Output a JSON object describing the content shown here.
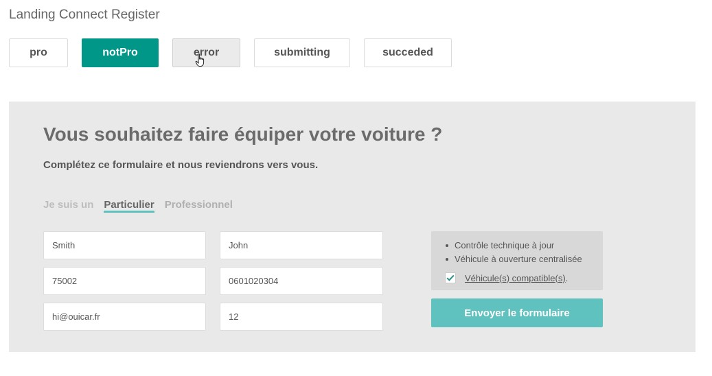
{
  "header": {
    "title": "Landing Connect Register"
  },
  "state_tabs": [
    {
      "label": "pro",
      "state": "default"
    },
    {
      "label": "notPro",
      "state": "active"
    },
    {
      "label": "error",
      "state": "hover"
    },
    {
      "label": "submitting",
      "state": "default"
    },
    {
      "label": "succeded",
      "state": "default"
    }
  ],
  "form": {
    "title": "Vous souhaitez faire équiper votre voiture ?",
    "subtitle": "Complétez ce formulaire et nous reviendrons vers vous.",
    "user_type": {
      "label": "Je suis un",
      "options": [
        "Particulier",
        "Professionnel"
      ],
      "selected": "Particulier"
    },
    "fields": {
      "last_name": {
        "value": "Smith"
      },
      "first_name": {
        "value": "John"
      },
      "postal_code": {
        "value": "75002"
      },
      "phone": {
        "value": "0601020304"
      },
      "email": {
        "value": "hi@ouicar.fr"
      },
      "vehicle_age": {
        "value": "12"
      }
    },
    "requirements": [
      "Contrôle technique à jour",
      "Véhicule à ouverture centralisée"
    ],
    "compatible_checkbox": {
      "label": "Véhicule(s) compatible(s)",
      "suffix": ".",
      "checked": true
    },
    "submit_label": "Envoyer le formulaire"
  },
  "colors": {
    "accent": "#009688",
    "accent_light": "#5fc2be",
    "panel_bg": "#e9e9e9",
    "info_bg": "#d8d8d8"
  },
  "icons": {
    "cursor": "hand-pointer-icon",
    "check": "check-icon"
  }
}
